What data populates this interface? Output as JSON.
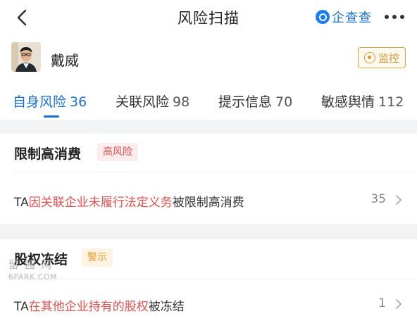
{
  "nav": {
    "title": "风险扫描",
    "brand": "企查查",
    "back_icon": "chevron-left-icon",
    "more_icon": "more-dots-icon"
  },
  "person": {
    "name": "戴威",
    "monitor_label": "监控"
  },
  "tabs": [
    {
      "label": "自身风险",
      "count": "36",
      "active": true
    },
    {
      "label": "关联风险",
      "count": "98",
      "active": false
    },
    {
      "label": "提示信息",
      "count": "70",
      "active": false
    },
    {
      "label": "敏感舆情",
      "count": "112",
      "active": false
    }
  ],
  "sections": [
    {
      "title": "限制高消费",
      "badge": "高风险",
      "row": {
        "prefix": "TA",
        "highlight": "因关联企业未履行法定义务",
        "suffix": "被限制高消费",
        "count": "35"
      }
    },
    {
      "title": "股权冻结",
      "badge": "警示",
      "row": {
        "prefix": "TA",
        "highlight": "在其他企业持有的股权",
        "suffix": "被冻结",
        "count": "1"
      }
    }
  ],
  "watermark": {
    "line1": "留园网",
    "line2": "6PARK.COM"
  },
  "colors": {
    "accent": "#1a6fd6",
    "risk_red": "#e35050",
    "warn_orange": "#e99a30",
    "monitor_gold": "#d99530",
    "gap_gray": "#f2f3f5"
  }
}
